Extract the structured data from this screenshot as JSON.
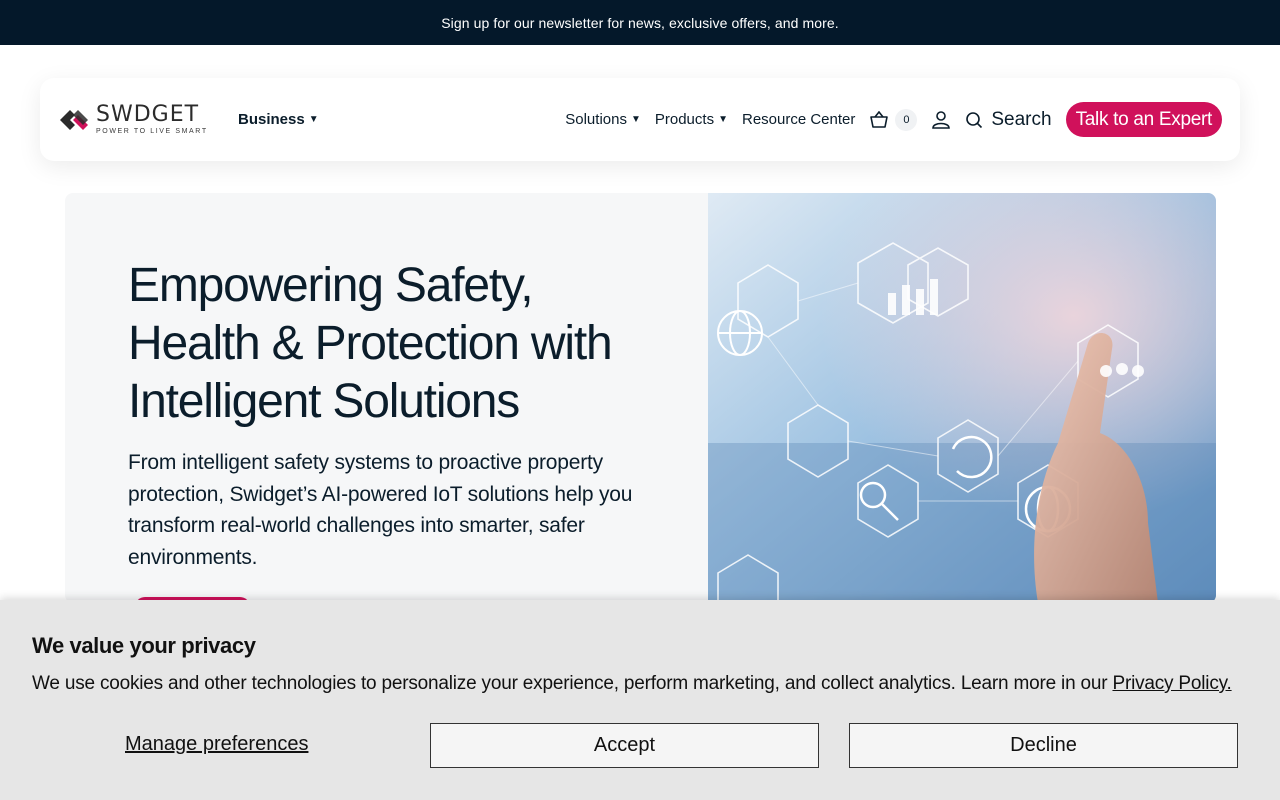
{
  "announcement": {
    "text": "Sign up for our newsletter for news, exclusive offers, and more."
  },
  "header": {
    "logo": {
      "word": "SWDGET",
      "tagline": "POWER TO LIVE SMART"
    },
    "segment_label": "Business",
    "nav": [
      {
        "label": "Solutions",
        "has_menu": true
      },
      {
        "label": "Products",
        "has_menu": true
      },
      {
        "label": "Resource Center",
        "has_menu": false
      }
    ],
    "cart_count": "0",
    "search_label": "Search",
    "cta_label": "Talk to an Expert"
  },
  "hero": {
    "title": "Empowering Safety, Health & Protection with Intelligent Solutions",
    "text": "From intelligent safety systems to proactive property protection, Swidget’s AI-powered IoT solutions help you transform real-world challenges into smarter, safer environments."
  },
  "consent": {
    "title": "We value your privacy",
    "text": "We use cookies and other technologies to personalize your experience, perform marketing, and collect analytics. Learn more in our ",
    "link_label": "Privacy Policy.",
    "manage_label": "Manage preferences",
    "accept_label": "Accept",
    "decline_label": "Decline"
  },
  "colors": {
    "brand": "#d0115b",
    "dark": "#04182a",
    "heading": "#0b1d2b",
    "banner_bg": "#e6e6e6"
  }
}
